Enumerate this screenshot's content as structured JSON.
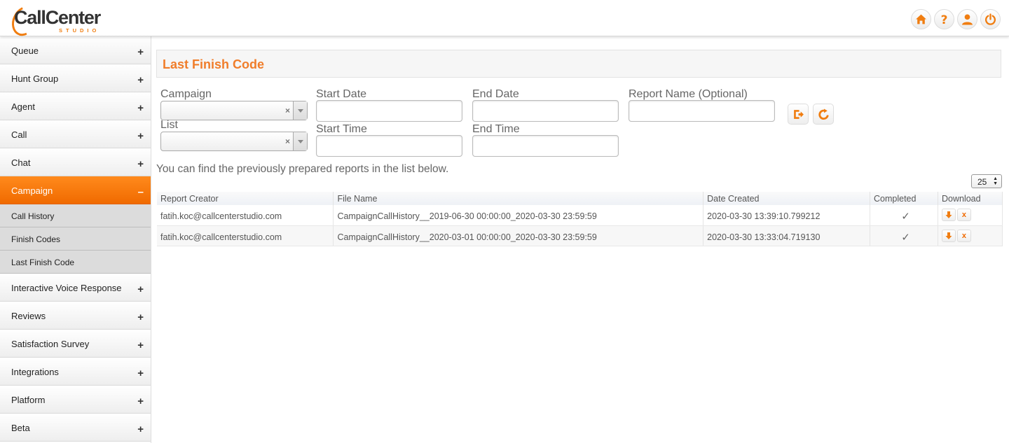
{
  "brand": {
    "logo_text": "CallCenter",
    "logo_sub": "STUDIO",
    "accent": "#f07d10"
  },
  "header_icons": [
    "home-icon",
    "help-icon",
    "user-icon",
    "power-icon"
  ],
  "sidebar": {
    "items": [
      {
        "label": "Queue",
        "sign": "+"
      },
      {
        "label": "Hunt Group",
        "sign": "+"
      },
      {
        "label": "Agent",
        "sign": "+"
      },
      {
        "label": "Call",
        "sign": "+"
      },
      {
        "label": "Chat",
        "sign": "+"
      },
      {
        "label": "Campaign",
        "sign": "–"
      },
      {
        "label": "Interactive Voice Response",
        "sign": "+"
      },
      {
        "label": "Reviews",
        "sign": "+"
      },
      {
        "label": "Satisfaction Survey",
        "sign": "+"
      },
      {
        "label": "Integrations",
        "sign": "+"
      },
      {
        "label": "Platform",
        "sign": "+"
      },
      {
        "label": "Beta",
        "sign": "+"
      }
    ],
    "sub_items": [
      {
        "label": "Call History"
      },
      {
        "label": "Finish Codes"
      },
      {
        "label": "Last Finish Code"
      }
    ]
  },
  "page": {
    "title": "Last Finish Code"
  },
  "form": {
    "campaign_label": "Campaign",
    "list_label": "List",
    "start_date_label": "Start Date",
    "end_date_label": "End Date",
    "report_name_label": "Report Name (Optional)",
    "start_time_label": "Start Time",
    "end_time_label": "End Time",
    "clear_glyph": "×"
  },
  "info_text": "You can find the previously prepared reports in the list below.",
  "page_size": "25",
  "table": {
    "headers": [
      "Report Creator",
      "File Name",
      "Date Created",
      "Completed",
      "Download"
    ],
    "rows": [
      {
        "creator": "fatih.koc@callcenterstudio.com",
        "file": "CampaignCallHistory__2019-06-30 00:00:00_2020-03-30 23:59:59",
        "date": "2020-03-30 13:39:10.799212",
        "completed": "✓"
      },
      {
        "creator": "fatih.koc@callcenterstudio.com",
        "file": "CampaignCallHistory__2020-03-01 00:00:00_2020-03-30 23:59:59",
        "date": "2020-03-30 13:33:04.719130",
        "completed": "✓"
      }
    ],
    "delete_glyph": "x"
  }
}
